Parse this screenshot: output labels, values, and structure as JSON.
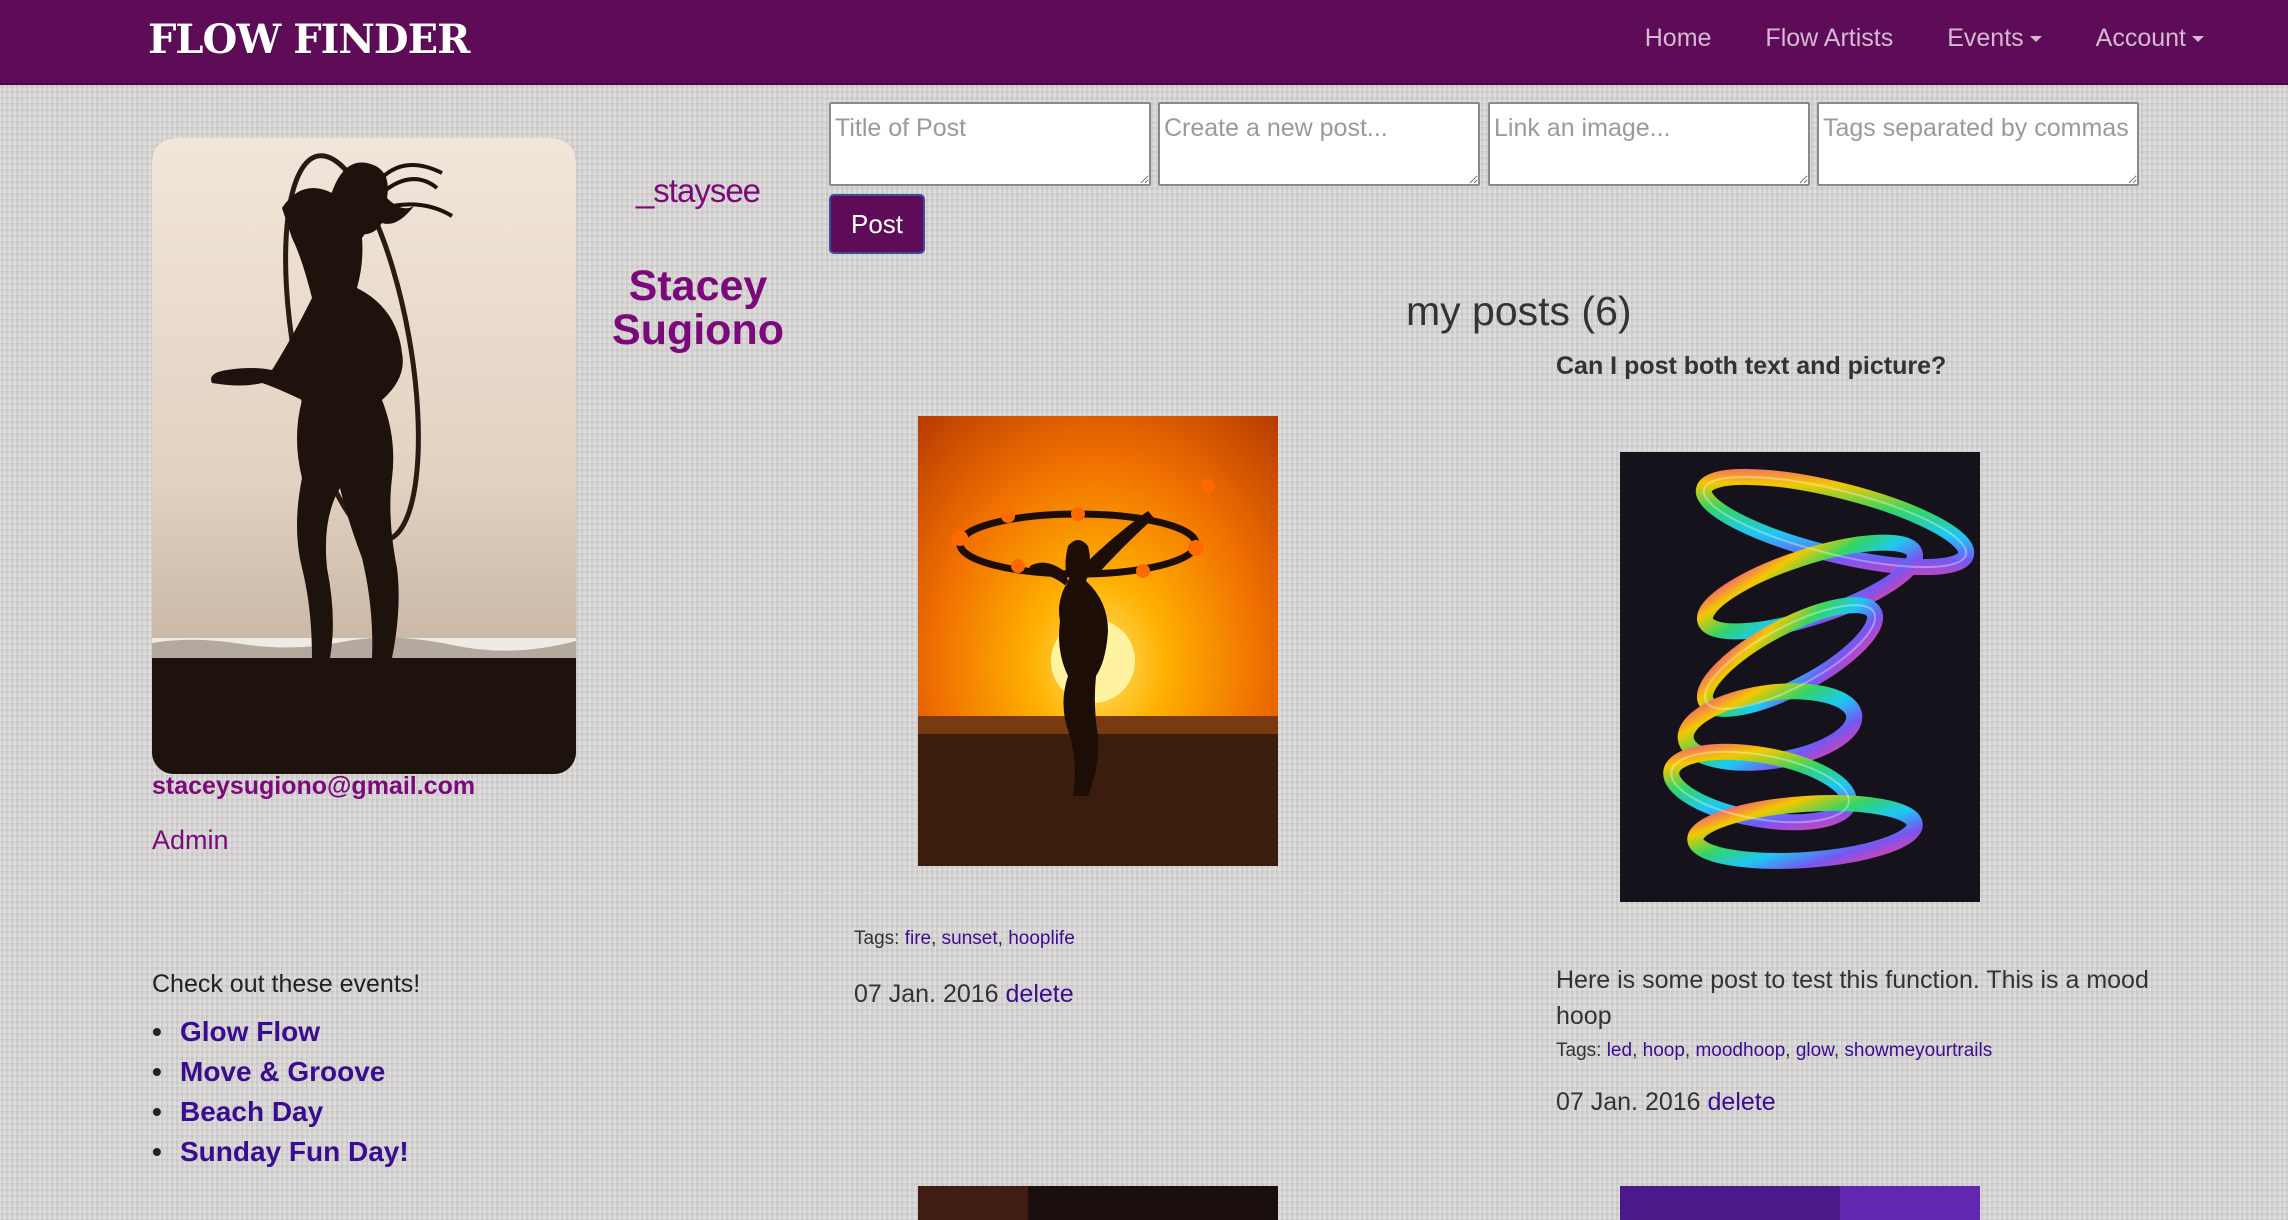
{
  "navbar": {
    "brand": "FLOW FINDER",
    "links": [
      "Home",
      "Flow Artists",
      "Events",
      "Account"
    ]
  },
  "profile": {
    "username": "_staysee",
    "full_name": "Stacey Sugiono",
    "email": "staceysugiono@gmail.com",
    "role": "Admin"
  },
  "events": {
    "heading": "Check out these events!",
    "items": [
      "Glow Flow",
      "Move & Groove",
      "Beach Day",
      "Sunday Fun Day!"
    ]
  },
  "post_form": {
    "title_placeholder": "Title of Post",
    "body_placeholder": "Create a new post...",
    "image_placeholder": "Link an image...",
    "tags_placeholder": "Tags separated by commas",
    "submit_label": "Post"
  },
  "posts_section": {
    "title": "my posts (6)"
  },
  "posts": [
    {
      "caption": "",
      "body": "",
      "tags_label": "Tags:",
      "tags": [
        "fire",
        "sunset",
        "hooplife"
      ],
      "date": "07 Jan. 2016",
      "delete_label": "delete"
    },
    {
      "caption": "Can I post both text and picture?",
      "body": "Here is some post to test this function. This is a mood hoop",
      "tags_label": "Tags:",
      "tags": [
        "led",
        "hoop",
        "moodhoop",
        "glow",
        "showmeyourtrails"
      ],
      "date": "07 Jan. 2016",
      "delete_label": "delete"
    }
  ],
  "icons": {
    "caret": "chevron-down-icon",
    "bullet": "bullet-icon"
  },
  "colors": {
    "navbar": "#5e0c58",
    "accent": "#7a0a7a",
    "link": "#3a0d8f"
  }
}
